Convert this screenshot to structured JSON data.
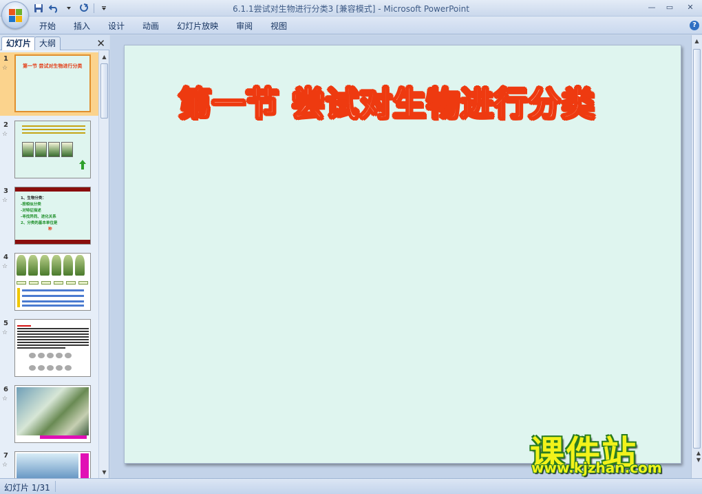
{
  "window": {
    "title": "6.1.1尝试对生物进行分类3 [兼容模式] - Microsoft PowerPoint",
    "minimize": "—",
    "restore": "▭",
    "close": "✕"
  },
  "ribbon": {
    "tabs": [
      "开始",
      "插入",
      "设计",
      "动画",
      "幻灯片放映",
      "审阅",
      "视图"
    ],
    "help": "?"
  },
  "panel": {
    "tabs": [
      "幻灯片",
      "大纲"
    ],
    "close": "✕",
    "slides": [
      {
        "num": "1",
        "title": "第一节  尝试对生物进行分类"
      },
      {
        "num": "2"
      },
      {
        "num": "3",
        "lines": [
          "1、生物分类：",
          "-按相似分类",
          "-对特征描述",
          "-寻找异同、进化关系",
          "2、分类的基本单位是",
          "种"
        ]
      },
      {
        "num": "4"
      },
      {
        "num": "5"
      },
      {
        "num": "6"
      },
      {
        "num": "7"
      }
    ]
  },
  "slide": {
    "title": "第一节  尝试对生物进行分类"
  },
  "watermark": {
    "big": "课件站",
    "url": "www.kjzhan.com"
  },
  "status": {
    "slide_counter": "幻灯片 1/31"
  },
  "colors": {
    "accent": "#ee3a10",
    "slide_bg": "#dff5ef",
    "selected_thumb": "#fbd38d"
  }
}
